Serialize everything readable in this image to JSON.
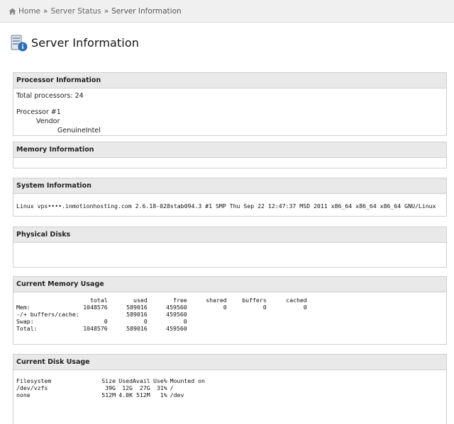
{
  "breadcrumb": {
    "home": "Home",
    "separator": "»",
    "server_status": "Server Status",
    "current": "Server Information"
  },
  "page": {
    "title": "Server Information",
    "icon": "server-info-icon"
  },
  "processor": {
    "header": "Processor Information",
    "total_label": "Total processors: 24",
    "processor_name": "Processor #1",
    "vendor_label": "Vendor",
    "vendor_value": "GenuineIntel"
  },
  "memory": {
    "header": "Memory Information"
  },
  "system": {
    "header": "System Information",
    "uname": "Linux vps••••.inmotionhosting.com 2.6.18-028stab094.3 #1 SMP Thu Sep 22 12:47:37 MSD 2011 x86_64 x86_64 x86_64 GNU/Linux"
  },
  "disks": {
    "header": "Physical Disks"
  },
  "memory_usage": {
    "header": "Current Memory Usage",
    "columns": [
      "",
      "total",
      "used",
      "free",
      "shared",
      "buffers",
      "cached"
    ],
    "rows": [
      [
        "Mem:",
        "1048576",
        "589016",
        "459560",
        "0",
        "0",
        "0"
      ],
      [
        "-/+ buffers/cache:",
        "",
        "589016",
        "459560",
        "",
        "",
        ""
      ],
      [
        "Swap:",
        "0",
        "0",
        "0",
        "",
        "",
        ""
      ],
      [
        "Total:",
        "1048576",
        "589016",
        "459560",
        "",
        "",
        ""
      ]
    ]
  },
  "disk_usage": {
    "header": "Current Disk Usage",
    "columns": [
      "Filesystem",
      "Size",
      "Used",
      "Avail",
      "Use%",
      "Mounted on"
    ],
    "rows": [
      [
        "/dev/vzfs",
        "39G",
        "12G",
        "27G",
        "31%",
        "/"
      ],
      [
        "none",
        "512M",
        "4.0K",
        "512M",
        "1%",
        "/dev"
      ]
    ]
  },
  "colors": {
    "header_bg": "#e9e9e9",
    "border": "#cfcfcf",
    "breadcrumb_bg": "#f0f0f0"
  }
}
